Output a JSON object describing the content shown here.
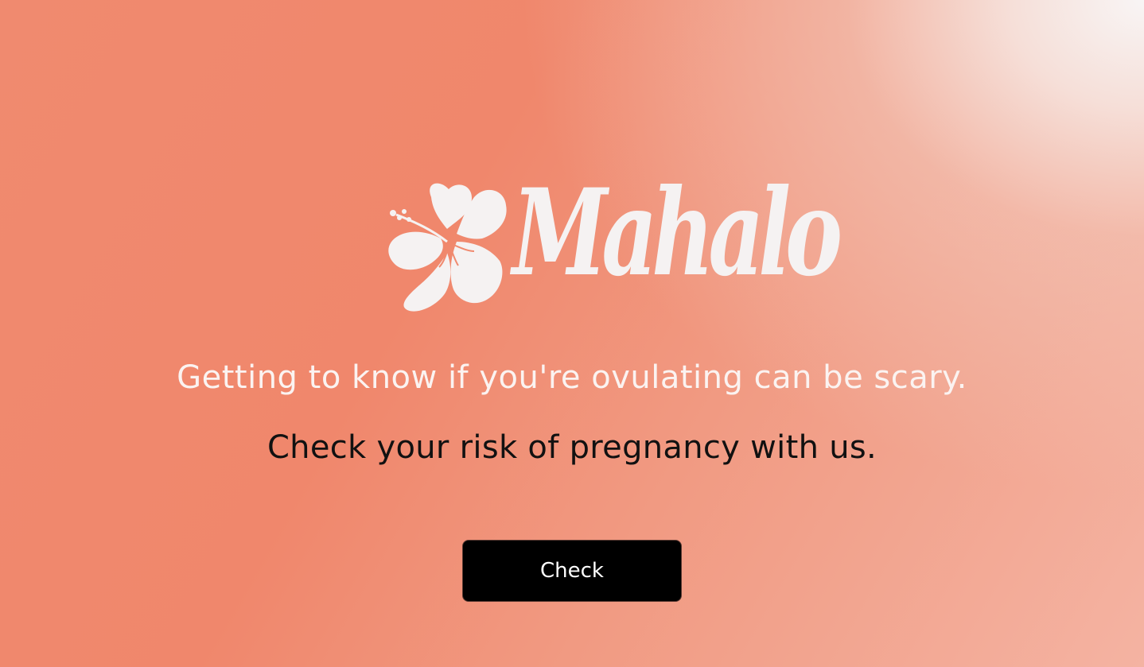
{
  "brand": {
    "name": "Mahalo",
    "logo_icon": "hibiscus-flower-icon",
    "logo_color": "#f5f2f2"
  },
  "hero": {
    "tagline": "Getting to know if you're ovulating can be scary.",
    "subline": "Check your risk of pregnancy with us."
  },
  "cta": {
    "label": "Check"
  },
  "colors": {
    "background_main": "#f0876c",
    "background_highlight": "#f8f5f5",
    "button_background": "#000000",
    "button_text": "#ffffff",
    "tagline_text": "#fbf3f1",
    "subline_text": "#111111"
  }
}
